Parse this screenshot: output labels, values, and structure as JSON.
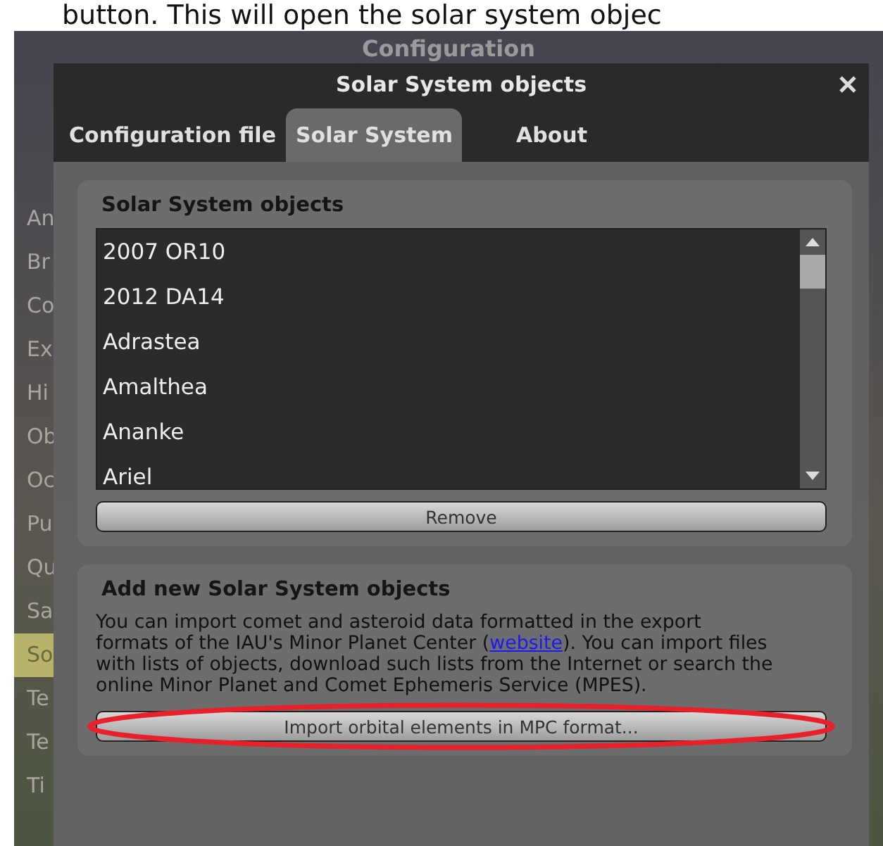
{
  "caption": "button. This will open the solar system objec",
  "window": {
    "title": "Configuration"
  },
  "sidebar": {
    "items": [
      {
        "label": "An",
        "selected": false
      },
      {
        "label": "Br",
        "selected": false
      },
      {
        "label": "Co",
        "selected": false
      },
      {
        "label": "Ex",
        "selected": false
      },
      {
        "label": "Hi",
        "selected": false
      },
      {
        "label": "Ob",
        "selected": false
      },
      {
        "label": "Oc",
        "selected": false
      },
      {
        "label": "Pu",
        "selected": false
      },
      {
        "label": "Qu",
        "selected": false
      },
      {
        "label": "Sa",
        "selected": false
      },
      {
        "label": "So",
        "selected": true
      },
      {
        "label": "Te",
        "selected": false
      },
      {
        "label": "Te",
        "selected": false
      },
      {
        "label": "Ti",
        "selected": false
      }
    ]
  },
  "dialog": {
    "title": "Solar System objects",
    "tabs": [
      {
        "label": "Configuration file",
        "selected": false
      },
      {
        "label": "Solar System",
        "selected": true
      },
      {
        "label": "About",
        "selected": false
      }
    ],
    "objects_group": {
      "title": "Solar System objects",
      "items": [
        "2007 OR10",
        "2012 DA14",
        "Adrastea",
        "Amalthea",
        "Ananke",
        "Ariel"
      ],
      "remove_button": "Remove"
    },
    "add_group": {
      "title": "Add new Solar System objects",
      "text_before": "You can import comet and asteroid data formatted in the export formats of the IAU's Minor Planet Center (",
      "link": "website",
      "text_after": "). You can import files with lists of objects, download such lists from the Internet or search the online Minor Planet and Comet Ephemeris Service (MPES).",
      "import_button": "Import orbital elements in MPC format...",
      "highlighted": true
    }
  }
}
